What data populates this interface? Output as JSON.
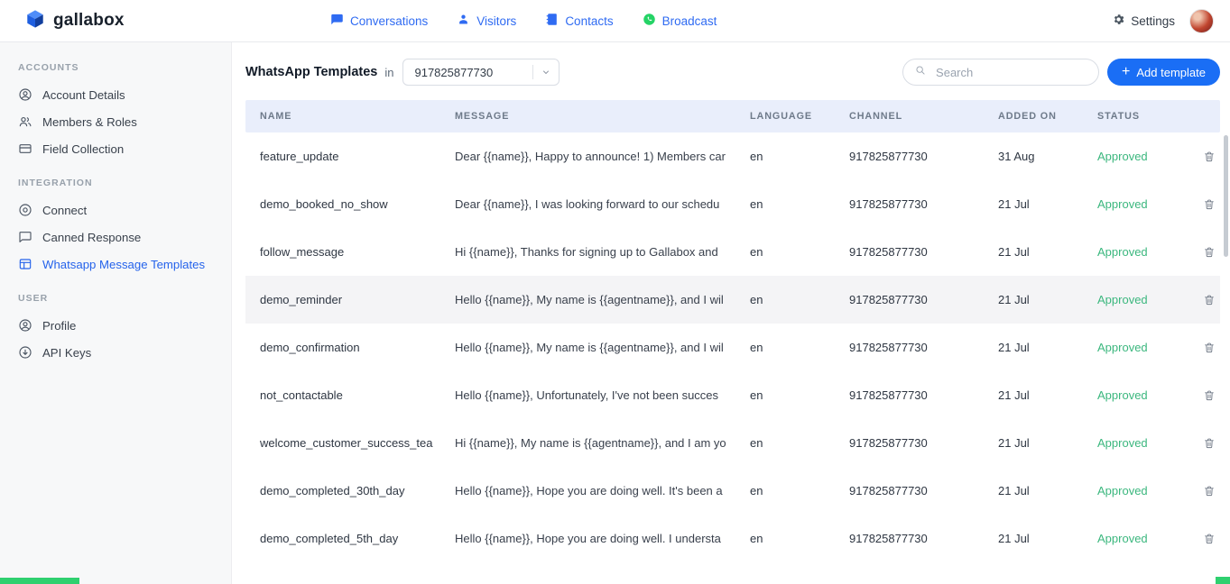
{
  "topnav": {
    "logo_text": "gallabox",
    "items": [
      {
        "label": "Conversations"
      },
      {
        "label": "Visitors"
      },
      {
        "label": "Contacts"
      },
      {
        "label": "Broadcast"
      }
    ],
    "settings_label": "Settings"
  },
  "sidebar": {
    "sections": [
      {
        "title": "ACCOUNTS",
        "items": [
          {
            "label": "Account Details"
          },
          {
            "label": "Members & Roles"
          },
          {
            "label": "Field Collection"
          }
        ]
      },
      {
        "title": "INTEGRATION",
        "items": [
          {
            "label": "Connect"
          },
          {
            "label": "Canned Response"
          },
          {
            "label": "Whatsapp Message Templates"
          }
        ]
      },
      {
        "title": "USER",
        "items": [
          {
            "label": "Profile"
          },
          {
            "label": "API Keys"
          }
        ]
      }
    ],
    "active_item": "Whatsapp Message Templates"
  },
  "main": {
    "title": "WhatsApp Templates",
    "in_label": "in",
    "channel_selector_value": "917825877730",
    "search_placeholder": "Search",
    "add_template_label": "Add template"
  },
  "table": {
    "columns": [
      "NAME",
      "MESSAGE",
      "LANGUAGE",
      "CHANNEL",
      "ADDED ON",
      "STATUS"
    ],
    "highlighted_row_index": 3,
    "rows": [
      {
        "name": "feature_update",
        "message": "Dear {{name}}, Happy to announce! 1) Members car",
        "language": "en",
        "channel": "917825877730",
        "added_on": "31 Aug",
        "status": "Approved"
      },
      {
        "name": "demo_booked_no_show",
        "message": "Dear {{name}}, I was looking forward to our schedu",
        "language": "en",
        "channel": "917825877730",
        "added_on": "21 Jul",
        "status": "Approved"
      },
      {
        "name": "follow_message",
        "message": "Hi {{name}}, Thanks for signing up to Gallabox and",
        "language": "en",
        "channel": "917825877730",
        "added_on": "21 Jul",
        "status": "Approved"
      },
      {
        "name": "demo_reminder",
        "message": "Hello {{name}}, My name is {{agentname}}, and I wil",
        "language": "en",
        "channel": "917825877730",
        "added_on": "21 Jul",
        "status": "Approved"
      },
      {
        "name": "demo_confirmation",
        "message": "Hello {{name}}, My name is {{agentname}}, and I wil",
        "language": "en",
        "channel": "917825877730",
        "added_on": "21 Jul",
        "status": "Approved"
      },
      {
        "name": "not_contactable",
        "message": "Hello {{name}}, Unfortunately, I've not been succes",
        "language": "en",
        "channel": "917825877730",
        "added_on": "21 Jul",
        "status": "Approved"
      },
      {
        "name": "welcome_customer_success_tea",
        "message": "Hi {{name}}, My name is {{agentname}}, and I am yo",
        "language": "en",
        "channel": "917825877730",
        "added_on": "21 Jul",
        "status": "Approved"
      },
      {
        "name": "demo_completed_30th_day",
        "message": "Hello {{name}}, Hope you are doing well. It's been a",
        "language": "en",
        "channel": "917825877730",
        "added_on": "21 Jul",
        "status": "Approved"
      },
      {
        "name": "demo_completed_5th_day",
        "message": "Hello {{name}}, Hope you are doing well. I understa",
        "language": "en",
        "channel": "917825877730",
        "added_on": "21 Jul",
        "status": "Approved"
      }
    ]
  },
  "colors": {
    "accent_blue": "#2f6bf2",
    "sidebar_active_blue": "#2563eb",
    "add_button_blue": "#1a6ef5",
    "approved_green": "#3bb77e",
    "whatsapp_green": "#25d366",
    "table_header_bg": "#e9eefb",
    "sidebar_bg": "#f7f8f9"
  }
}
